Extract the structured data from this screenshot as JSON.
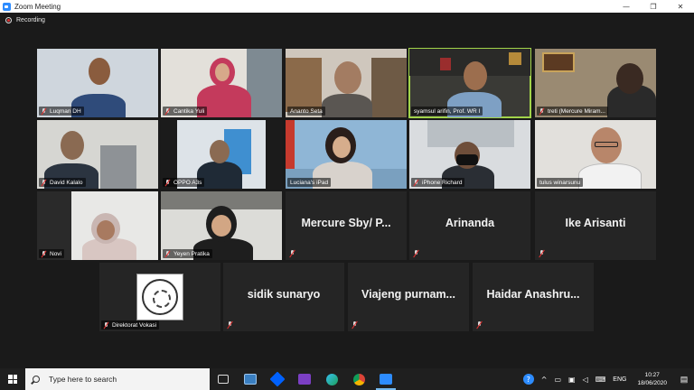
{
  "window": {
    "title": "Zoom Meeting"
  },
  "recording": {
    "label": "Recording"
  },
  "participants": [
    {
      "name": "Luqman DH"
    },
    {
      "name": "Cantika Yuli"
    },
    {
      "name": "Ananto Seta"
    },
    {
      "name": "syamsul arifin, Prof. WR I"
    },
    {
      "name": "treti (Mercure Miram..."
    },
    {
      "name": "David Kalalo"
    },
    {
      "name": "OPPO A3s"
    },
    {
      "name": "Luciana's iPad"
    },
    {
      "name": "iPhone Richard"
    },
    {
      "name": "tulus winarsunu"
    },
    {
      "name": "Novi"
    },
    {
      "name": "Yeyen Pratika"
    },
    {
      "name": "Mercure Sby/ P..."
    },
    {
      "name": "Arinanda"
    },
    {
      "name": "Ike Arisanti"
    },
    {
      "name": "Direktorat Vokasi"
    },
    {
      "name": "sidik sunaryo"
    },
    {
      "name": "Viajeng purnam..."
    },
    {
      "name": "Haidar Anashru..."
    }
  ],
  "taskbar": {
    "search_placeholder": "Type here to search",
    "language": "ENG",
    "time": "10:27",
    "date": "18/06/2020"
  },
  "colors": {
    "active_speaker": "#a2d44a",
    "muted": "#e02f2f",
    "zoom_blue": "#2d8cff"
  }
}
